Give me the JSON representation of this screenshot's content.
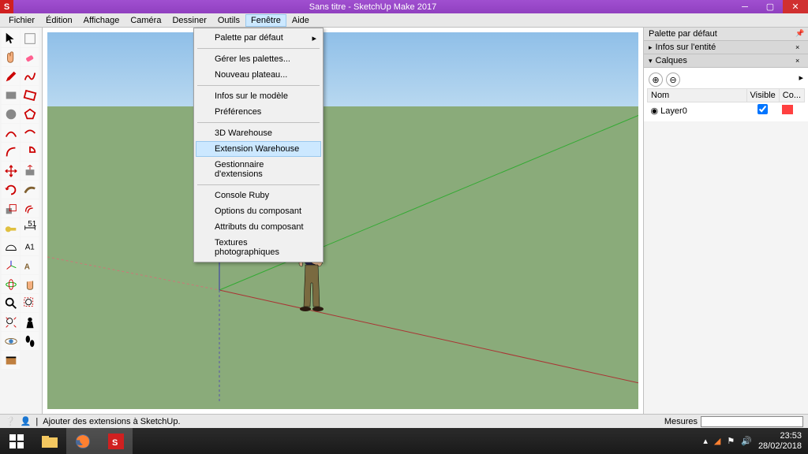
{
  "window": {
    "title": "Sans titre - SketchUp Make 2017"
  },
  "menubar": {
    "items": [
      "Fichier",
      "Édition",
      "Affichage",
      "Caméra",
      "Dessiner",
      "Outils",
      "Fenêtre",
      "Aide"
    ],
    "active_index": 6
  },
  "dropdown": {
    "items": [
      {
        "label": "Palette par défaut",
        "arrow": true
      },
      {
        "sep": true
      },
      {
        "label": "Gérer les palettes..."
      },
      {
        "label": "Nouveau plateau..."
      },
      {
        "sep": true
      },
      {
        "label": "Infos sur le modèle"
      },
      {
        "label": "Préférences"
      },
      {
        "sep": true
      },
      {
        "label": "3D Warehouse"
      },
      {
        "label": "Extension Warehouse",
        "highlight": true
      },
      {
        "label": "Gestionnaire d'extensions"
      },
      {
        "sep": true
      },
      {
        "label": "Console Ruby"
      },
      {
        "label": "Options du composant"
      },
      {
        "label": "Attributs du composant"
      },
      {
        "label": "Textures photographiques"
      }
    ]
  },
  "rightpanel": {
    "title": "Palette par défaut",
    "sect1": "Infos sur l'entité",
    "sect2": "Calques",
    "headers": {
      "name": "Nom",
      "visible": "Visible",
      "color": "Co..."
    },
    "layer": {
      "name": "Layer0",
      "checked": true
    }
  },
  "statusbar": {
    "hint": "Ajouter des extensions à SketchUp.",
    "measure_label": "Mesures"
  },
  "taskbar": {
    "time": "23:53",
    "date": "28/02/2018"
  }
}
